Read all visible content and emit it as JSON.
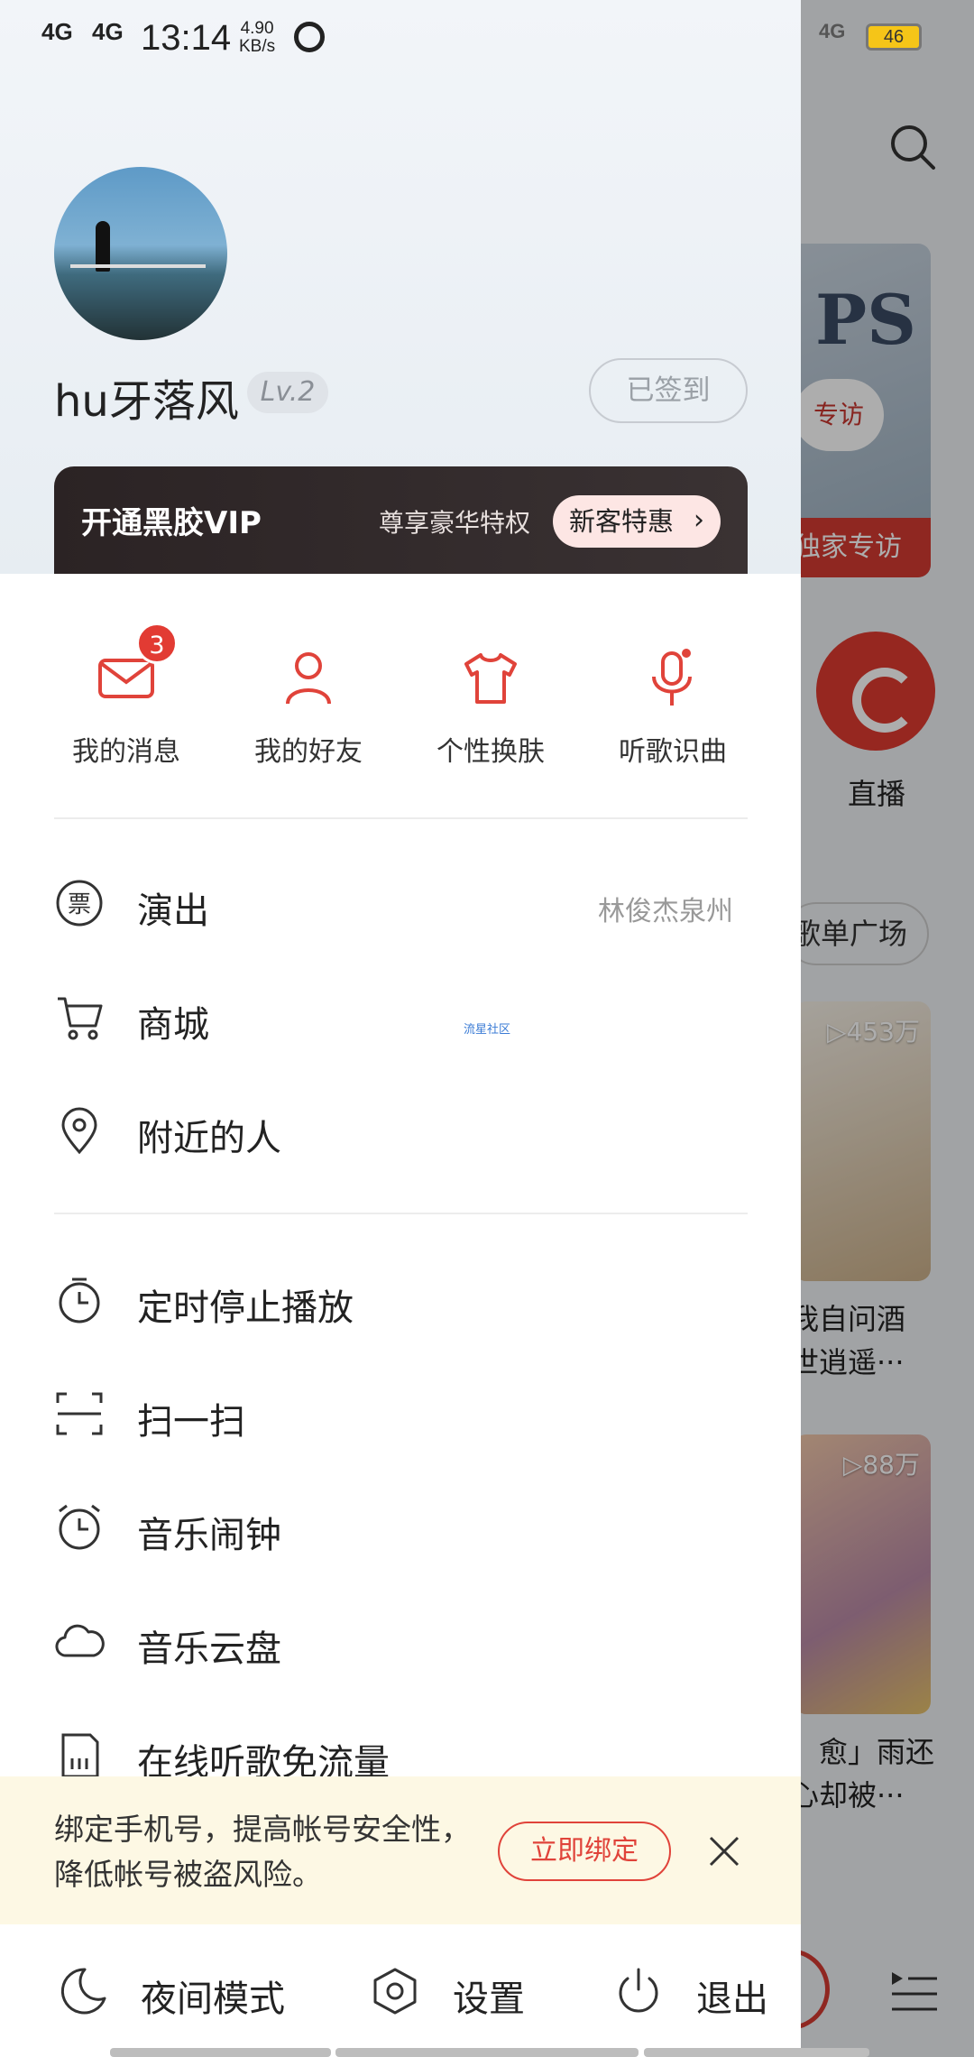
{
  "status_bar": {
    "signal1": "4G",
    "signal2": "4G",
    "time": "13:14",
    "speed_value": "4.90",
    "speed_unit": "KB/s",
    "right_signal": "4G",
    "battery": "46"
  },
  "profile": {
    "username": "hu牙落风",
    "level": "Lv.2",
    "signin_label": "已签到"
  },
  "vip": {
    "title": "开通黑胶VIP",
    "description": "尊享豪华特权",
    "offer_label": "新客特惠"
  },
  "quick_actions": [
    {
      "label": "我的消息",
      "icon": "mail-icon",
      "badge": "3"
    },
    {
      "label": "我的好友",
      "icon": "person-icon"
    },
    {
      "label": "个性换肤",
      "icon": "tshirt-icon"
    },
    {
      "label": "听歌识曲",
      "icon": "microphone-icon"
    }
  ],
  "menu_group1": [
    {
      "label": "演出",
      "icon": "ticket-icon",
      "extra": "林俊杰泉州"
    },
    {
      "label": "商城",
      "icon": "cart-icon"
    },
    {
      "label": "附近的人",
      "icon": "location-pin-icon"
    }
  ],
  "watermark": "流星社区",
  "menu_group2": [
    {
      "label": "定时停止播放",
      "icon": "timer-icon"
    },
    {
      "label": "扫一扫",
      "icon": "scan-icon"
    },
    {
      "label": "音乐闹钟",
      "icon": "alarm-clock-icon"
    },
    {
      "label": "音乐云盘",
      "icon": "cloud-icon"
    },
    {
      "label": "在线听歌免流量",
      "icon": "sim-card-icon"
    }
  ],
  "bind_notice": {
    "text": "绑定手机号，提高帐号安全性，降低帐号被盗风险。",
    "button": "立即绑定"
  },
  "bottom_bar": [
    {
      "label": "夜间模式",
      "icon": "moon-icon"
    },
    {
      "label": "设置",
      "icon": "settings-hexagon-icon"
    },
    {
      "label": "退出",
      "icon": "power-icon"
    }
  ],
  "background_app": {
    "banner_text": "PS",
    "banner_bubble": "专访",
    "banner_strip": "独家专访",
    "live_label": "直播",
    "playlist_pill": "歌单广场",
    "card1_plays": "▷453万",
    "card1_title_line1": "我自问酒",
    "card1_title_line2": "世逍遥···",
    "card2_plays": "▷88万",
    "card2_title_line1": "」愈」雨还",
    "card2_title_line2": "心却被···"
  },
  "colors": {
    "accent": "#e0433a",
    "vip_bg": "#2b2324",
    "notice_bg": "#fdf8e4"
  }
}
